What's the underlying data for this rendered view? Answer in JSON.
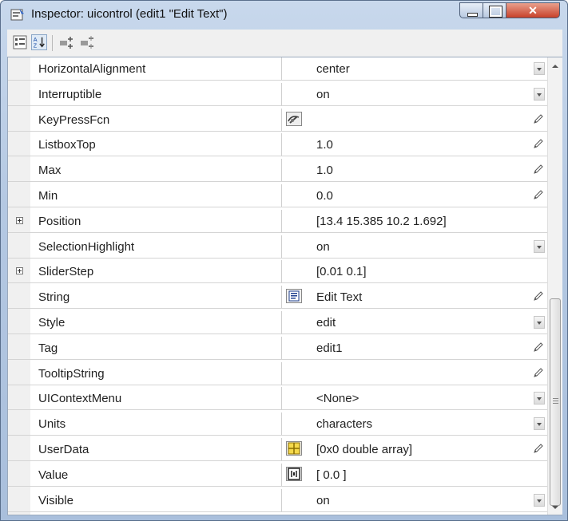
{
  "window": {
    "title": "Inspector:  uicontrol (edit1 \"Edit Text\")",
    "close_glyph": "✕"
  },
  "toolbar": {
    "buttons": [
      "categorized-icon",
      "sort-alphabetical-icon",
      "expand-all-icon",
      "collapse-all-icon"
    ]
  },
  "properties": [
    {
      "name": "HorizontalAlignment",
      "value": "center",
      "control": "dropdown"
    },
    {
      "name": "Interruptible",
      "value": "on",
      "control": "dropdown"
    },
    {
      "name": "KeyPressFcn",
      "value": "",
      "control": "pencil",
      "tool": "callback-editor-icon"
    },
    {
      "name": "ListboxTop",
      "value": "1.0",
      "control": "pencil"
    },
    {
      "name": "Max",
      "value": "1.0",
      "control": "pencil"
    },
    {
      "name": "Min",
      "value": "0.0",
      "control": "pencil"
    },
    {
      "name": "Position",
      "value": "[13.4 15.385 10.2 1.692]",
      "control": "none",
      "expandable": true
    },
    {
      "name": "SelectionHighlight",
      "value": "on",
      "control": "dropdown"
    },
    {
      "name": "SliderStep",
      "value": "[0.01 0.1]",
      "control": "none",
      "expandable": true
    },
    {
      "name": "String",
      "value": "Edit Text",
      "control": "pencil",
      "tool": "text-editor-icon"
    },
    {
      "name": "Style",
      "value": "edit",
      "control": "dropdown"
    },
    {
      "name": "Tag",
      "value": "edit1",
      "control": "pencil"
    },
    {
      "name": "TooltipString",
      "value": "",
      "control": "pencil"
    },
    {
      "name": "UIContextMenu",
      "value": "<None>",
      "control": "dropdown"
    },
    {
      "name": "Units",
      "value": "characters",
      "control": "dropdown"
    },
    {
      "name": "UserData",
      "value": "[0x0  double array]",
      "control": "pencil",
      "tool": "array-editor-icon"
    },
    {
      "name": "Value",
      "value": "[ 0.0 ]",
      "control": "none",
      "tool": "value-editor-icon"
    },
    {
      "name": "Visible",
      "value": "on",
      "control": "dropdown"
    }
  ]
}
